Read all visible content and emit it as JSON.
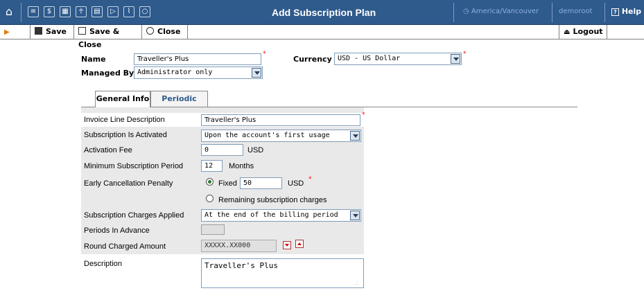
{
  "topbar": {
    "title": "Add Subscription Plan",
    "timezone": "America/Vancouver",
    "user": "demoroot",
    "help_label": "Help"
  },
  "toolbar": {
    "save_label": "Save",
    "save_close_label": "Save & Close",
    "close_label": "Close",
    "logout_label": "Logout"
  },
  "header_form": {
    "name_label": "Name",
    "name_value": "Traveller's Plus",
    "currency_label": "Currency",
    "currency_value": "USD - US Dollar",
    "managed_by_label": "Managed By",
    "managed_by_value": "Administrator only"
  },
  "tabs": [
    {
      "label": "General Info"
    },
    {
      "label": "Periodic Fees"
    }
  ],
  "general": {
    "invoice_line_label": "Invoice Line Description",
    "invoice_line_value": "Traveller's Plus",
    "activated_label": "Subscription Is Activated",
    "activated_value": "Upon the account's first usage",
    "activation_fee_label": "Activation Fee",
    "activation_fee_value": "0",
    "activation_fee_unit": "USD",
    "min_period_label": "Minimum Subscription Period",
    "min_period_value": "12",
    "min_period_unit": "Months",
    "early_cancel_label": "Early Cancellation Penalty",
    "fixed_label": "Fixed",
    "fixed_value": "50",
    "fixed_unit": "USD",
    "remaining_label": "Remaining subscription charges",
    "charges_applied_label": "Subscription Charges Applied",
    "charges_applied_value": "At the end of the billing period",
    "periods_advance_label": "Periods In Advance",
    "round_label": "Round Charged Amount",
    "round_value": "XXXXX.XX000",
    "description_label": "Description",
    "description_value": "Traveller's Plus"
  }
}
